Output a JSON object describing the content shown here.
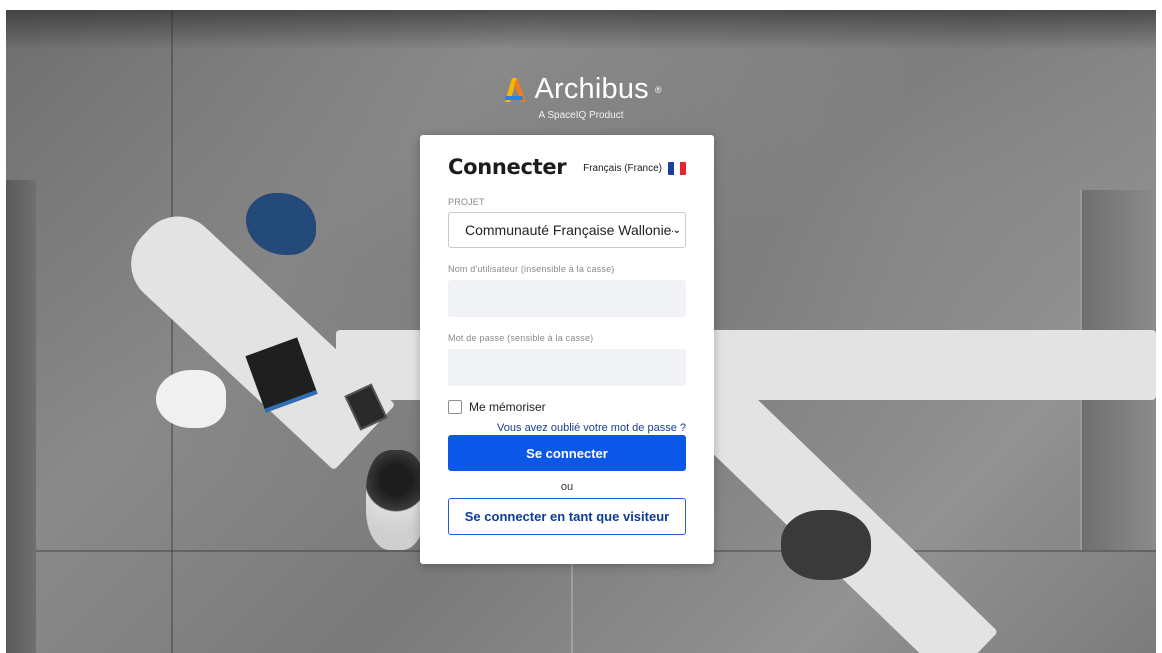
{
  "brand": {
    "name": "Archibus",
    "trademark": "®",
    "tagline": "A SpaceIQ Product"
  },
  "login": {
    "title": "Connecter",
    "language": {
      "label": "Français (France)",
      "flag_colors": [
        "#1a3f9e",
        "#ffffff",
        "#e0262e"
      ]
    },
    "project": {
      "label": "PROJET",
      "selected": "Communauté Française Wallonie-Bruxelles"
    },
    "username": {
      "label": "Nom d'utilisateur (insensible à la casse)",
      "value": ""
    },
    "password": {
      "label": "Mot de passe (sensible à la casse)",
      "value": ""
    },
    "remember_me": {
      "label": "Me mémoriser",
      "checked": false
    },
    "forgot_password": "Vous avez oublié votre mot de passe ?",
    "submit": "Se connecter",
    "or": "ou",
    "guest": "Se connecter en tant que visiteur"
  },
  "colors": {
    "primary": "#0b58e8",
    "link": "#1a3e92",
    "logo_yellow": "#f5b800",
    "logo_orange": "#f07c1f",
    "logo_blue": "#2f7fd6"
  }
}
